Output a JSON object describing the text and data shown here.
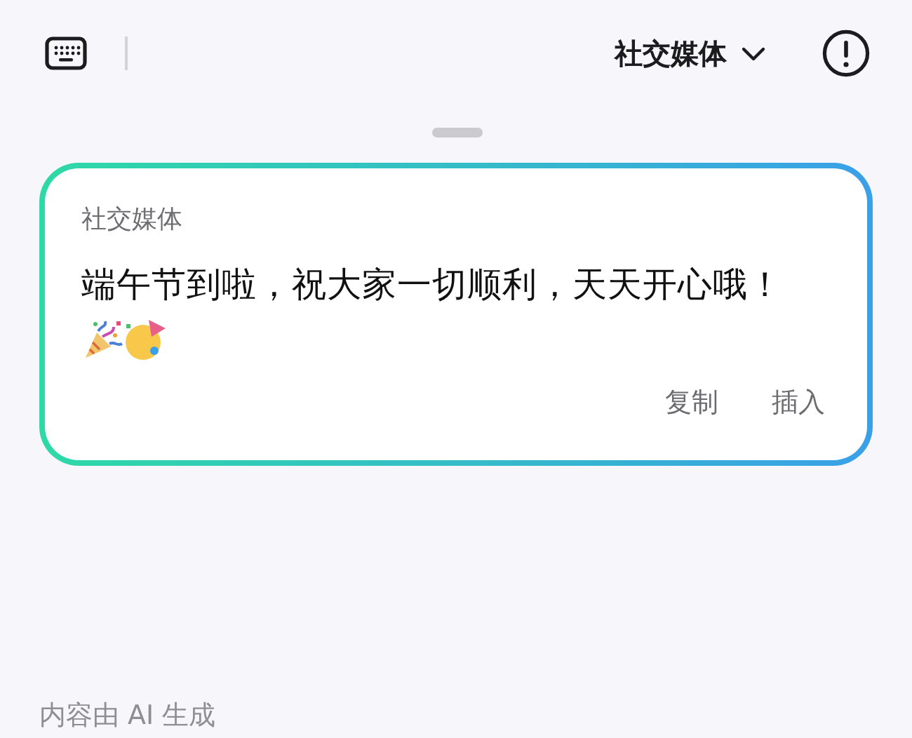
{
  "header": {
    "category": "社交媒体"
  },
  "card": {
    "label": "社交媒体",
    "message": "端午节到啦，祝大家一切顺利，天天开心哦！",
    "actions": [
      {
        "label": "复制"
      },
      {
        "label": "插入"
      }
    ]
  },
  "footer": "内容由 AI 生成"
}
